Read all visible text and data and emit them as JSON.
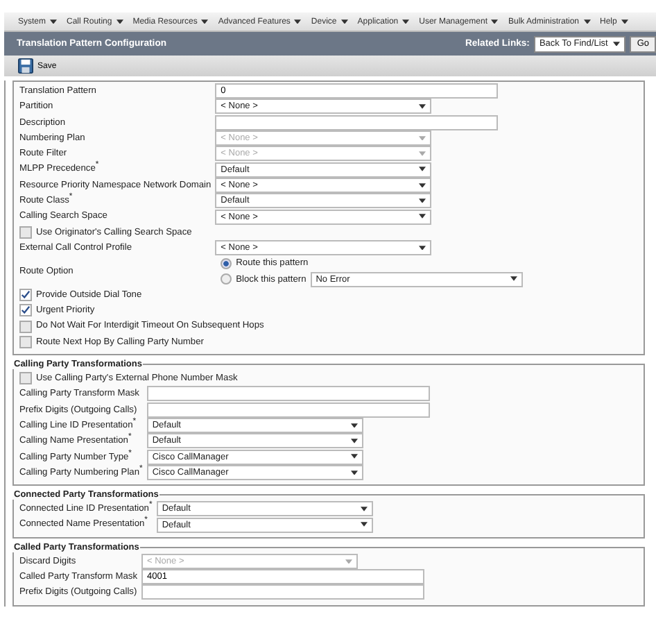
{
  "menu": [
    {
      "label": "System"
    },
    {
      "label": "Call Routing"
    },
    {
      "label": "Media Resources"
    },
    {
      "label": "Advanced Features"
    },
    {
      "label": "Device"
    },
    {
      "label": "Application"
    },
    {
      "label": "User Management"
    },
    {
      "label": "Bulk Administration"
    },
    {
      "label": "Help"
    }
  ],
  "header": {
    "title": "Translation Pattern Configuration",
    "related_label": "Related Links:",
    "related_value": "Back To Find/List",
    "go": "Go"
  },
  "toolbar": {
    "save": "Save"
  },
  "sections": [
    {
      "fields": [
        {
          "kind": "text",
          "label": "Translation Pattern",
          "value": "0"
        },
        {
          "kind": "select",
          "label": "Partition",
          "value": "< None >",
          "disabled": false
        },
        {
          "kind": "text",
          "label": "Description"
        },
        {
          "kind": "select",
          "label": "Numbering Plan",
          "value": "< None >",
          "disabled": true
        },
        {
          "kind": "select",
          "label": "Route Filter",
          "value": "< None >",
          "disabled": true
        },
        {
          "kind": "select",
          "label": "MLPP Precedence$^{*}$",
          "value": "Default",
          "disabled": false
        },
        {
          "kind": "select",
          "label": "Resource Priority Namespace Network Domain",
          "value": "< None >",
          "disabled": false
        },
        {
          "kind": "select",
          "label": "Route Class$^{*}$",
          "value": "Default",
          "disabled": false
        },
        {
          "kind": "select",
          "label": "Calling Search Space",
          "value": "< None >",
          "disabled": false
        },
        {
          "kind": "checkbox",
          "label": "Use Originator's Calling Search Space",
          "checked": false
        },
        {
          "kind": "select",
          "label": "External Call Control Profile",
          "value": "< None >",
          "disabled": false
        },
        {
          "kind": "radio",
          "label": "Route Option",
          "options": [
            {
              "label": "Route this pattern",
              "selected": true
            },
            {
              "label": "Block this pattern",
              "selected": false,
              "select_value": "No Error"
            }
          ]
        },
        {
          "kind": "checkbox",
          "label": "Provide Outside Dial Tone",
          "checked": true
        },
        {
          "kind": "checkbox",
          "label": "Urgent Priority",
          "checked": true
        },
        {
          "kind": "checkbox",
          "label": "Do Not Wait For Interdigit Timeout On Subsequent Hops",
          "checked": false
        },
        {
          "kind": "checkbox",
          "label": "Route Next Hop By Calling Party Number",
          "checked": false
        }
      ]
    },
    {
      "title": "Calling Party Transformations",
      "fields": [
        {
          "kind": "checkbox",
          "label": "Use Calling Party's External Phone Number Mask",
          "checked": false
        },
        {
          "kind": "text",
          "label": "Calling Party Transform Mask"
        },
        {
          "kind": "text",
          "label": "Prefix Digits (Outgoing Calls)"
        },
        {
          "kind": "select",
          "label": "Calling Line ID Presentation$^{*}$",
          "value": "Default",
          "disabled": false
        },
        {
          "kind": "select",
          "label": "Calling Name Presentation$^{*}$",
          "value": "Default",
          "disabled": false
        },
        {
          "kind": "select",
          "label": "Calling Party Number Type$^{*}$",
          "value": "Cisco CallManager",
          "disabled": false
        },
        {
          "kind": "select",
          "label": "Calling Party Numbering Plan$^{*}$",
          "value": "Cisco CallManager",
          "disabled": false
        }
      ]
    },
    {
      "title": "Connected Party Transformations",
      "fields": [
        {
          "kind": "select",
          "label": "Connected Line ID Presentation$^{*}$",
          "value": "Default",
          "disabled": false
        },
        {
          "kind": "select",
          "label": "Connected Name Presentation$^{*}$",
          "value": "Default",
          "disabled": false
        }
      ]
    },
    {
      "title": "Called Party Transformations",
      "fields": [
        {
          "kind": "select",
          "label": "Discard Digits",
          "value": "< None >",
          "disabled": true
        },
        {
          "kind": "text",
          "label": "Called Party Transform Mask",
          "value": "4001"
        },
        {
          "kind": "text",
          "label": "Prefix Digits (Outgoing Calls)"
        }
      ]
    }
  ]
}
